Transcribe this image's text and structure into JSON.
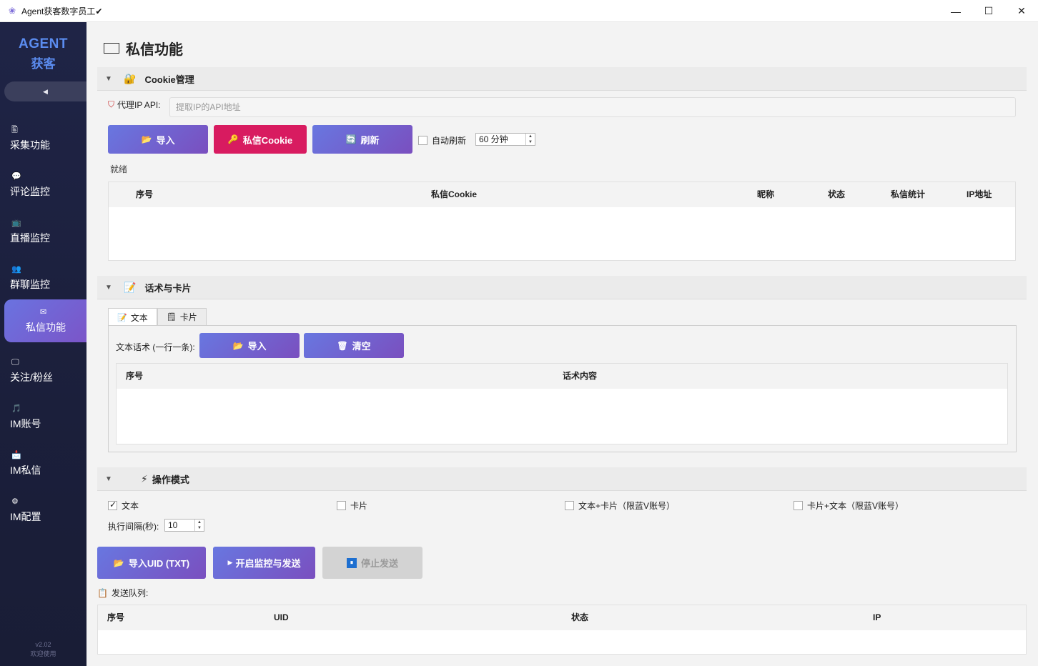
{
  "window": {
    "title": "Agent获客数字员工✔",
    "minimize": "—",
    "maximize": "☐",
    "close": "✕"
  },
  "sidebar": {
    "brand_line1": "AGENT",
    "brand_line2": "获客",
    "collapse_glyph": "◀",
    "items": [
      {
        "label": "采集功能",
        "icon": "🖺"
      },
      {
        "label": "评论监控",
        "icon": "💬"
      },
      {
        "label": "直播监控",
        "icon": "📺"
      },
      {
        "label": "群聊监控",
        "icon": "👥"
      },
      {
        "label": "私信功能",
        "icon": "✉"
      },
      {
        "label": "关注/粉丝",
        "icon": "🖵"
      },
      {
        "label": "IM账号",
        "icon": "🎵"
      },
      {
        "label": "IM私信",
        "icon": "📩"
      },
      {
        "label": "IM配置",
        "icon": "⚙"
      }
    ],
    "version": "v2.02",
    "welcome": "欢迎使用"
  },
  "page": {
    "title": "私信功能"
  },
  "cookie_section": {
    "title": "Cookie管理",
    "proxy_label": "代理IP API:",
    "proxy_placeholder": "提取IP的API地址",
    "import_label": "导入",
    "cookie_label": "私信Cookie",
    "refresh_label": "刷新",
    "auto_refresh_label": "自动刷新",
    "auto_refresh_checked": false,
    "interval_value": "60 分钟",
    "status": "就绪",
    "columns": [
      "序号",
      "私信Cookie",
      "昵称",
      "状态",
      "私信统计",
      "IP地址"
    ],
    "rows": []
  },
  "script_section": {
    "title": "话术与卡片",
    "tabs": [
      {
        "label": "文本",
        "icon": "📝",
        "active": true
      },
      {
        "label": "卡片",
        "icon": "🗒",
        "active": false
      }
    ],
    "text_label": "文本话术 (一行一条):",
    "import_label": "导入",
    "clear_label": "清空",
    "columns": [
      "序号",
      "话术内容"
    ],
    "rows": []
  },
  "mode_section": {
    "title": "操作模式",
    "options": [
      {
        "label": "文本",
        "checked": true
      },
      {
        "label": "卡片",
        "checked": false
      },
      {
        "label": "文本+卡片（限蓝V账号）",
        "checked": false
      },
      {
        "label": "卡片+文本（限蓝V账号）",
        "checked": false
      }
    ],
    "interval_label": "执行间隔(秒):",
    "interval_value": "10"
  },
  "actions": {
    "import_uid_label": "导入UID (TXT)",
    "start_label": "开启监控与发送",
    "stop_label": "停止发送",
    "stop_enabled": false
  },
  "queue": {
    "label": "发送队列:",
    "columns": [
      "序号",
      "UID",
      "状态",
      "IP"
    ],
    "rows": []
  }
}
